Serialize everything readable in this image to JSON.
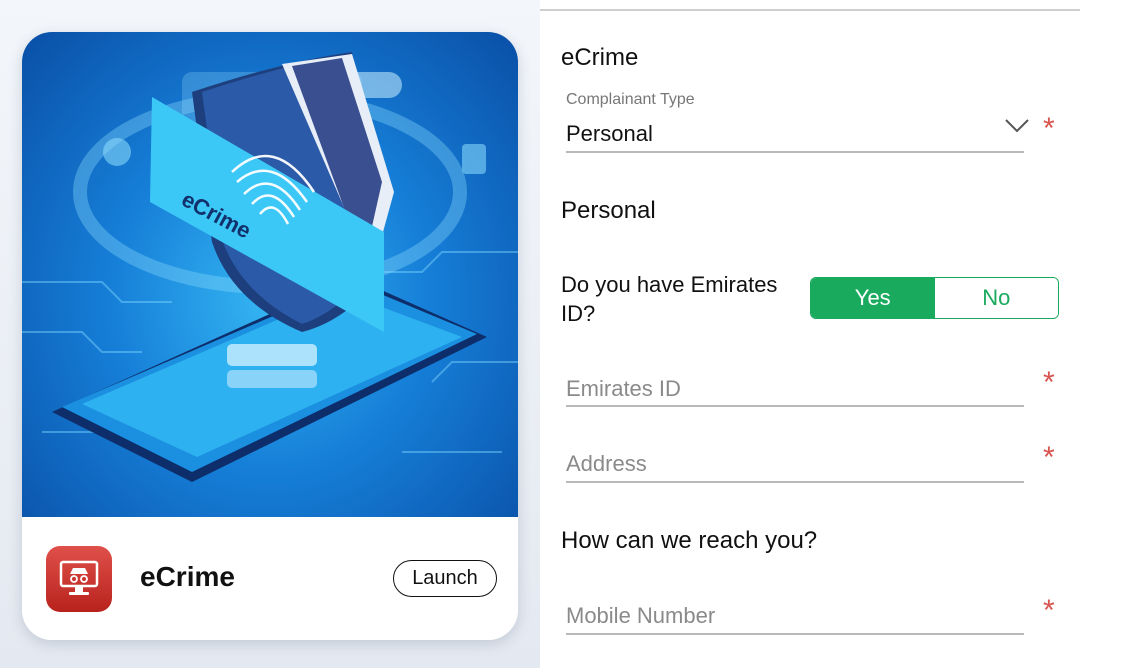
{
  "card": {
    "hero_caption": "eCrime",
    "app_name": "eCrime",
    "launch_label": "Launch"
  },
  "form": {
    "section_title": "eCrime",
    "complainant_type": {
      "label": "Complainant Type",
      "value": "Personal",
      "required_mark": "*"
    },
    "personal_section_title": "Personal",
    "emirates_question": "Do you have Emirates ID?",
    "toggle": {
      "yes_label": "Yes",
      "no_label": "No",
      "selected": "Yes"
    },
    "emirates_id": {
      "placeholder": "Emirates ID",
      "required_mark": "*"
    },
    "address": {
      "placeholder": "Address",
      "required_mark": "*"
    },
    "reach_title": "How can we reach you?",
    "mobile": {
      "placeholder": "Mobile Number",
      "required_mark": "*"
    }
  },
  "colors": {
    "accent_green": "#1aaa5e",
    "required_red": "#d9534f",
    "app_icon_red": "#c52d27"
  },
  "icons": [
    "chevron-down-icon",
    "monitor-spy-icon",
    "shield-icon",
    "fingerprint-icon"
  ]
}
